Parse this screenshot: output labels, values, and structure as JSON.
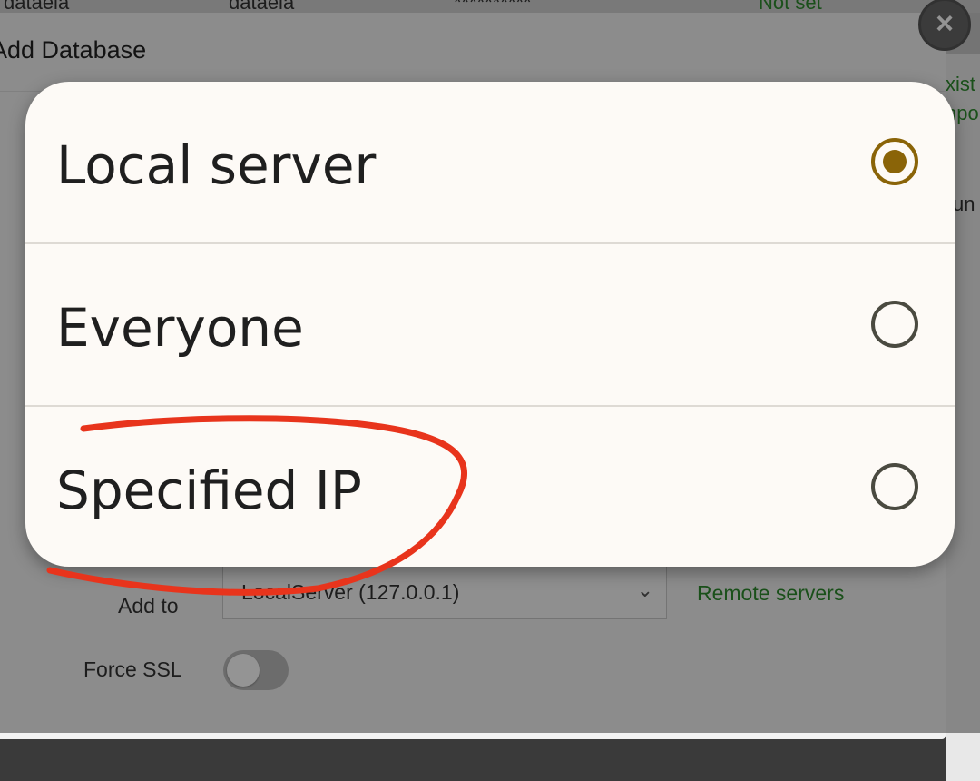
{
  "background": {
    "table_row": {
      "db_name": "dataela",
      "user_name": "dataela",
      "password_mask": "**********",
      "status": "Not set"
    },
    "dialog_title": "Add Database",
    "right_peek": [
      "xist",
      "npo",
      "un"
    ],
    "form": {
      "add_to_label": "Add to",
      "add_to_value": "LocalServer (127.0.0.1)",
      "remote_servers_link": "Remote servers",
      "force_ssl_label": "Force SSL",
      "force_ssl_on": false
    }
  },
  "access_options": {
    "items": [
      {
        "label": "Local server",
        "selected": true
      },
      {
        "label": "Everyone",
        "selected": false
      },
      {
        "label": "Specified IP",
        "selected": false
      }
    ]
  },
  "colors": {
    "radio_selected": "#8a6408",
    "annotation_stroke": "#e8341c",
    "link_green": "#2e8b2e"
  }
}
